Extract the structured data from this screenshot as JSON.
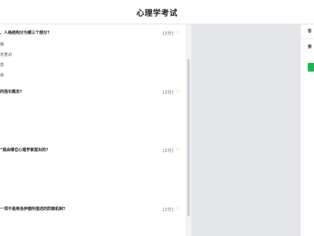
{
  "header": {
    "title": "心理学考试"
  },
  "right_panel": {
    "label1": "答",
    "label2": "第"
  },
  "questions": [
    {
      "text": "、人格结构分为哪三个部分?",
      "score": "[2分]",
      "options": [
        "我",
        "无意识",
        "念",
        "余"
      ]
    },
    {
      "text": "的强化概念?",
      "score": "[2分]",
      "options": []
    },
    {
      "text": "”是由哪位心理学家提出的?",
      "score": "[2分]",
      "options": []
    },
    {
      "text": "一项不是弗洛伊德所描述的防御机制?",
      "score": "[2分]",
      "options": []
    }
  ]
}
